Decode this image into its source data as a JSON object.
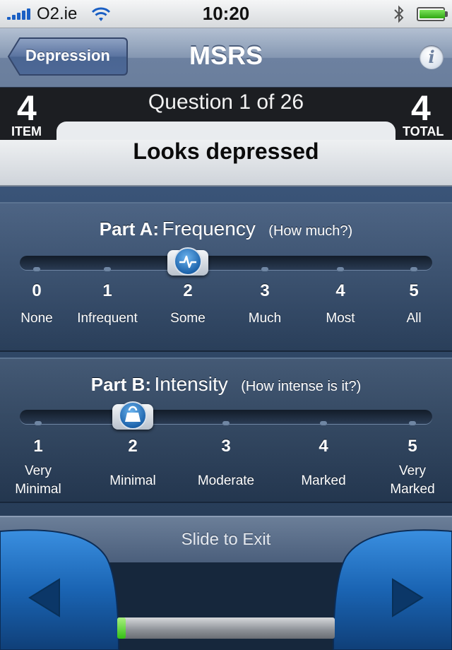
{
  "status_bar": {
    "carrier": "O2.ie",
    "time": "10:20",
    "signal_icon": "signal-bars-icon",
    "wifi_icon": "wifi-icon",
    "bluetooth_icon": "bluetooth-icon",
    "battery_icon": "battery-icon",
    "battery_level": 1.0
  },
  "nav": {
    "back_label": "Depression",
    "title": "MSRS",
    "info_icon": "info-icon",
    "info_symbol": "i"
  },
  "question": {
    "counter": "Question 1 of 26",
    "item_number": "4",
    "item_label": "ITEM",
    "total_number": "4",
    "total_label": "TOTAL",
    "label": "Looks depressed"
  },
  "part_a": {
    "prefix": "Part A:",
    "name": "Frequency",
    "hint": "(How much?)",
    "selected": 2,
    "thumb_icon": "waveform-icon",
    "options": [
      {
        "value": "0",
        "label": "None"
      },
      {
        "value": "1",
        "label": "Infrequent"
      },
      {
        "value": "2",
        "label": "Some"
      },
      {
        "value": "3",
        "label": "Much"
      },
      {
        "value": "4",
        "label": "Most"
      },
      {
        "value": "5",
        "label": "All"
      }
    ]
  },
  "part_b": {
    "prefix": "Part B:",
    "name": "Intensity",
    "hint": "(How intense is it?)",
    "selected": 2,
    "thumb_icon": "weight-icon",
    "options": [
      {
        "value": "1",
        "label": "Very Minimal"
      },
      {
        "value": "2",
        "label": "Minimal"
      },
      {
        "value": "3",
        "label": "Moderate"
      },
      {
        "value": "4",
        "label": "Marked"
      },
      {
        "value": "5",
        "label": "Very Marked"
      }
    ]
  },
  "footer": {
    "exit_label": "Slide to Exit",
    "prev_icon": "previous-arrow-icon",
    "next_icon": "next-arrow-icon",
    "progress": 0.04
  },
  "colors": {
    "nav_bar": "#7b8eab",
    "header_bg": "#1c1e22",
    "leather": "#2f4766",
    "accent_blue": "#1d64ac",
    "progress_green": "#33bf14"
  }
}
